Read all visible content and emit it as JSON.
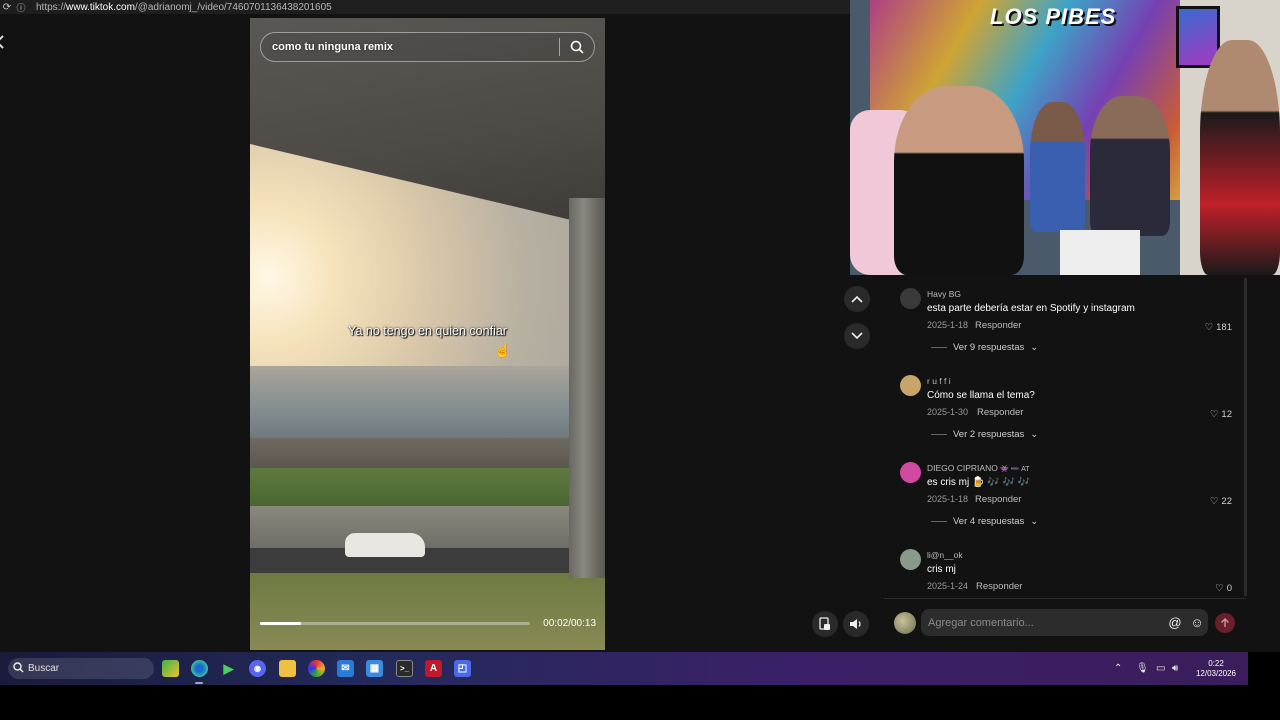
{
  "browser": {
    "url_prefix": "https://",
    "url_domain": "www.tiktok.com",
    "url_path": "/@adrianomj_/video/7460701136438201605"
  },
  "video": {
    "search_query": "como tu ninguna remix",
    "subtitle": "Ya no tengo en quien confiar",
    "timecode": "00:02/00:13",
    "progress_fraction": 0.15
  },
  "webcam": {
    "sign_text": "LOS PIBES"
  },
  "comments": [
    {
      "user": "Havy BG",
      "text": "esta parte debería estar en Spotify y instagram",
      "date": "2025-1-18",
      "reply": "Responder",
      "likes": "181",
      "more": "Ver 9 respuestas",
      "avatar_color": "#3a3a3a"
    },
    {
      "user": "r u f f i",
      "text": "Cómo se llama el tema?",
      "date": "2025-1-30",
      "reply": "Responder",
      "likes": "12",
      "more": "Ver 2 respuestas",
      "avatar_color": "#c8a46a"
    },
    {
      "user": "DIEGO CIPRIANO",
      "user_suffix": "👾 ➖ AT",
      "text": "es cris mj 🍺 🎶 🎶 🎶",
      "date": "2025-1-18",
      "reply": "Responder",
      "likes": "22",
      "more": "Ver 4 respuestas",
      "avatar_color": "#d04aa0"
    },
    {
      "user": "li@n__ok",
      "text": "cris mj",
      "date": "2025-1-24",
      "reply": "Responder",
      "likes": "0",
      "avatar_color": "#8a9a8a"
    }
  ],
  "comment_input": {
    "placeholder": "Agregar comentario..."
  },
  "taskbar": {
    "search_label": "Buscar",
    "time": "0:22",
    "date": "12/03/2026"
  }
}
